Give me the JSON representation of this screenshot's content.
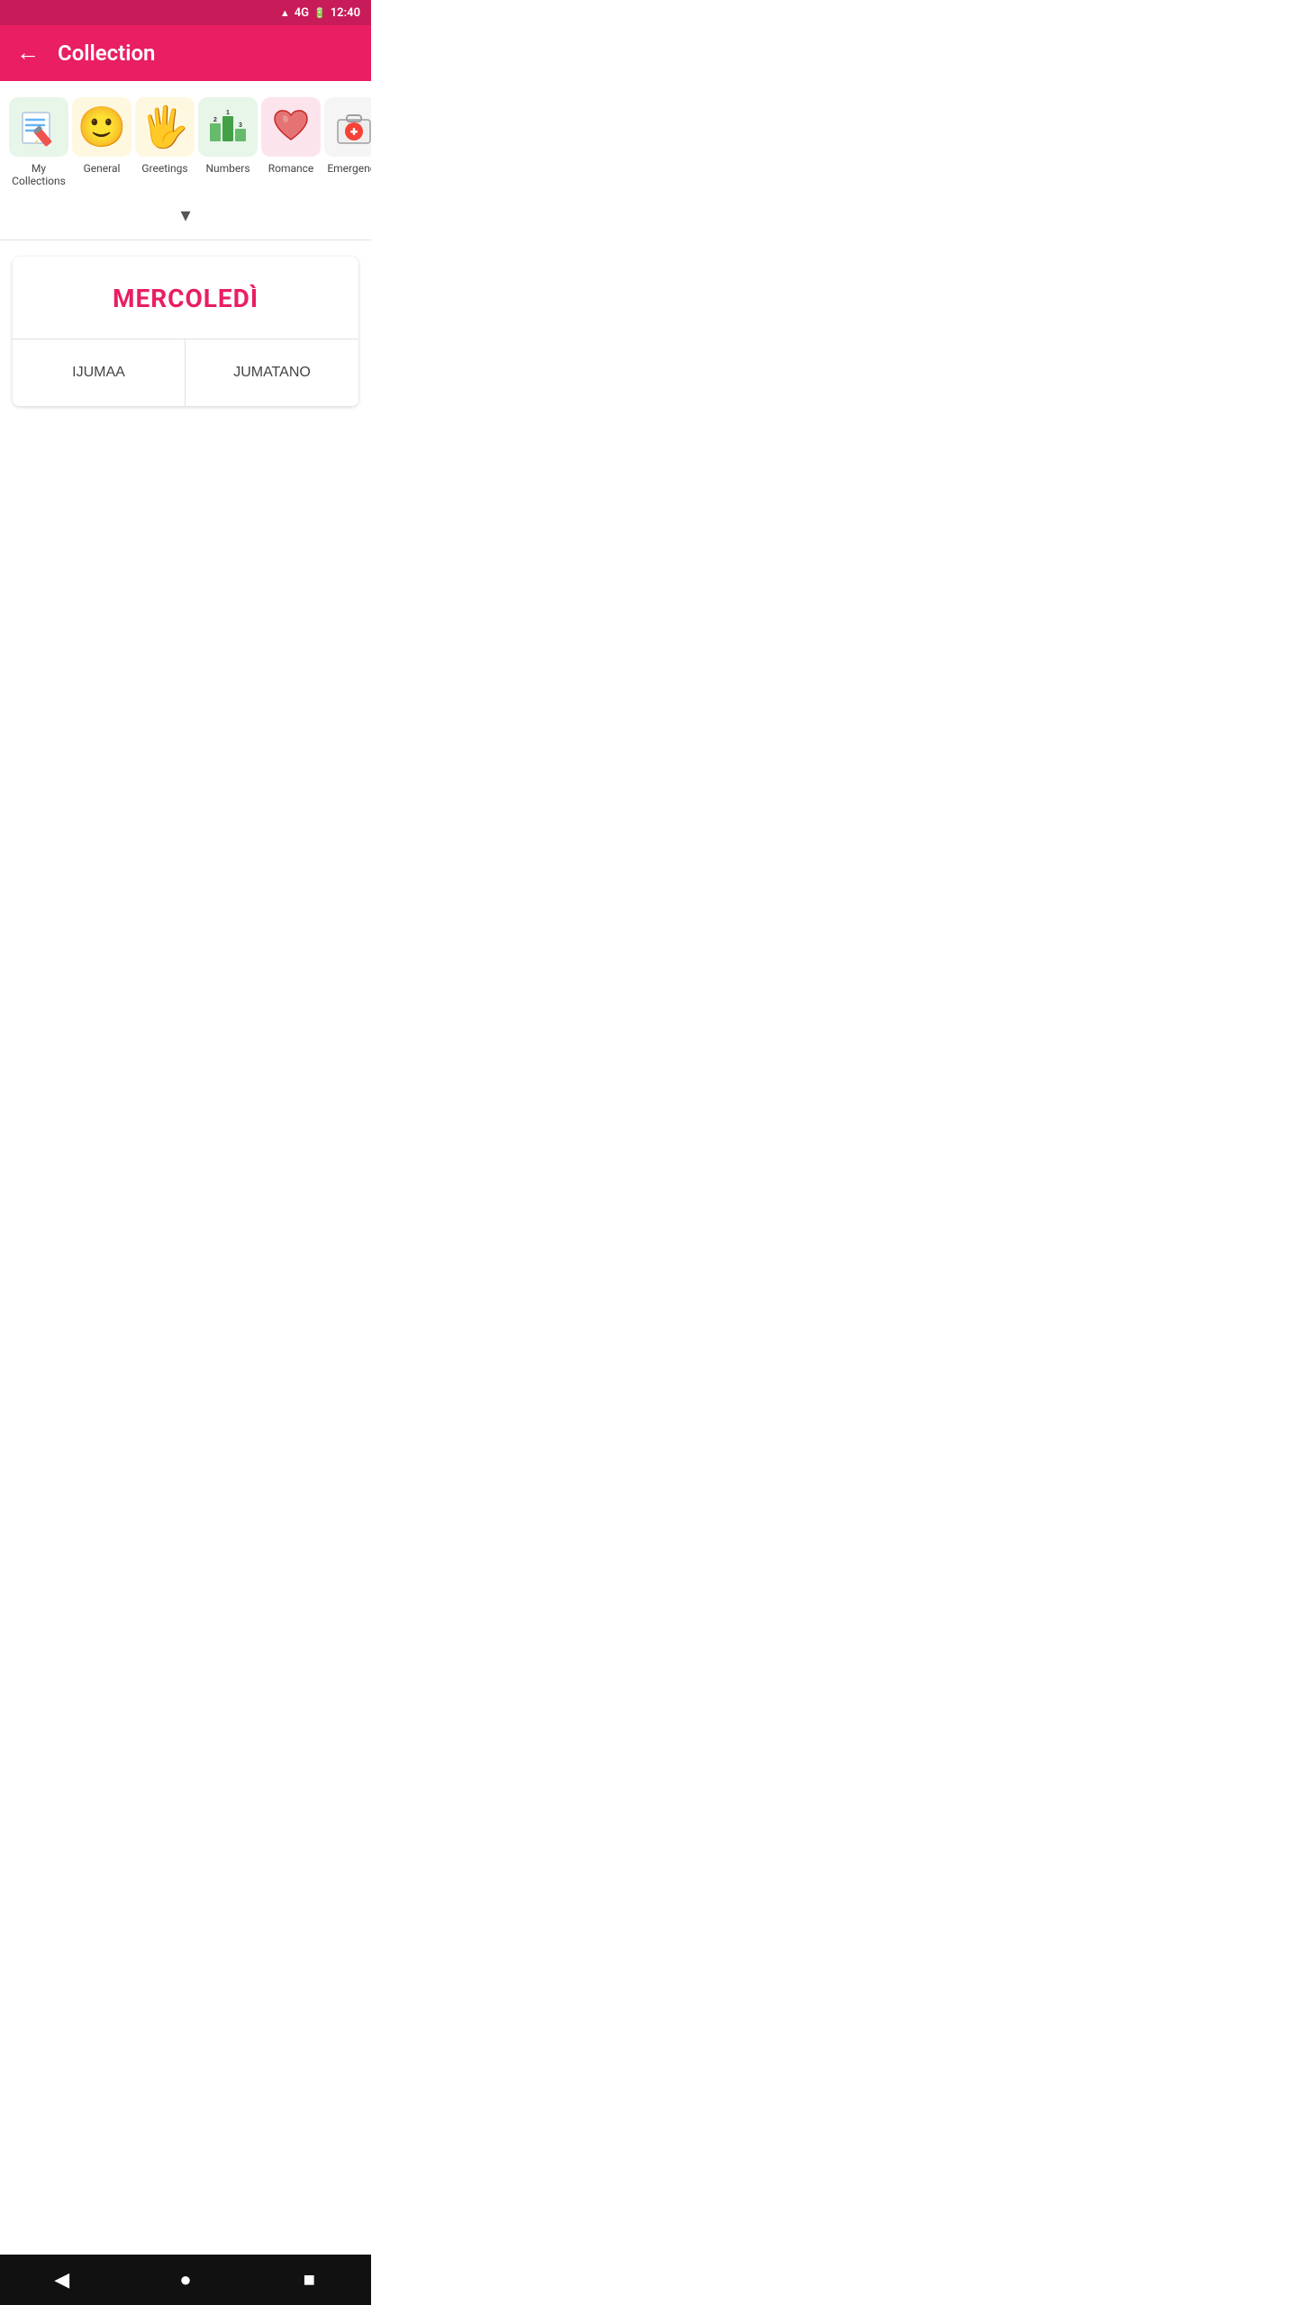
{
  "statusBar": {
    "signal": "4G",
    "time": "12:40"
  },
  "appBar": {
    "backLabel": "←",
    "title": "Collection"
  },
  "categories": [
    {
      "id": "my-collections",
      "label": "My Collections",
      "emoji": "📝",
      "type": "custom"
    },
    {
      "id": "general",
      "label": "General",
      "emoji": "😊",
      "type": "emoji"
    },
    {
      "id": "greetings",
      "label": "Greetings",
      "emoji": "🖐",
      "type": "emoji"
    },
    {
      "id": "numbers",
      "label": "Numbers",
      "emoji": "🔢",
      "type": "emoji"
    },
    {
      "id": "romance",
      "label": "Romance",
      "emoji": "❤️",
      "type": "emoji"
    },
    {
      "id": "emergency",
      "label": "Emergency",
      "emoji": "🧰",
      "type": "emoji"
    }
  ],
  "chevron": "▾",
  "quiz": {
    "word": "MERCOLEDÌ",
    "answers": [
      "IJUMAA",
      "JUMATANO"
    ]
  },
  "bottomNav": {
    "back": "◀",
    "home": "●",
    "square": "■"
  }
}
